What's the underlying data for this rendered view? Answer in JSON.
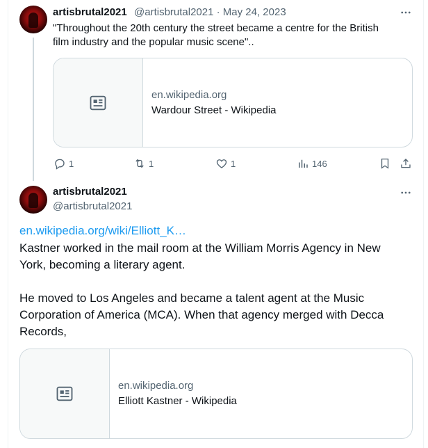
{
  "tweet1": {
    "name": "artisbrutal2021",
    "handle_date": "@artisbrutal2021 · May 24, 2023",
    "text_line1": "\"Throughout the 20th century the street became a centre for the British",
    "text_line2": "film industry and the popular music scene\"..",
    "card": {
      "domain": "en.wikipedia.org",
      "title": "Wardour Street - Wikipedia"
    },
    "actions": {
      "replies": "1",
      "retweets": "1",
      "likes": "1",
      "views": "146"
    }
  },
  "tweet2": {
    "name": "artisbrutal2021",
    "handle": "@artisbrutal2021",
    "link": "en.wikipedia.org/wiki/Elliott_K…",
    "p1_line1": "Kastner worked in the mail room at the William Morris Agency in New",
    "p1_line2": "York, becoming a literary agent.",
    "p2_line1": "He moved to Los Angeles and became a talent agent at the Music",
    "p2_line2": "Corporation of America (MCA). When that agency merged with Decca",
    "p2_line3": "Records,",
    "card": {
      "domain": "en.wikipedia.org",
      "title": "Elliott Kastner - Wikipedia"
    }
  },
  "icons": {
    "more": "more-horizontal-icon",
    "reply": "reply-icon",
    "retweet": "retweet-icon",
    "like": "heart-icon",
    "views": "views-chart-icon",
    "bookmark": "bookmark-icon",
    "share": "share-icon",
    "article": "article-icon"
  },
  "colors": {
    "link": "#1d9bf0",
    "secondary_text": "#536471",
    "border": "#cfd9de"
  }
}
